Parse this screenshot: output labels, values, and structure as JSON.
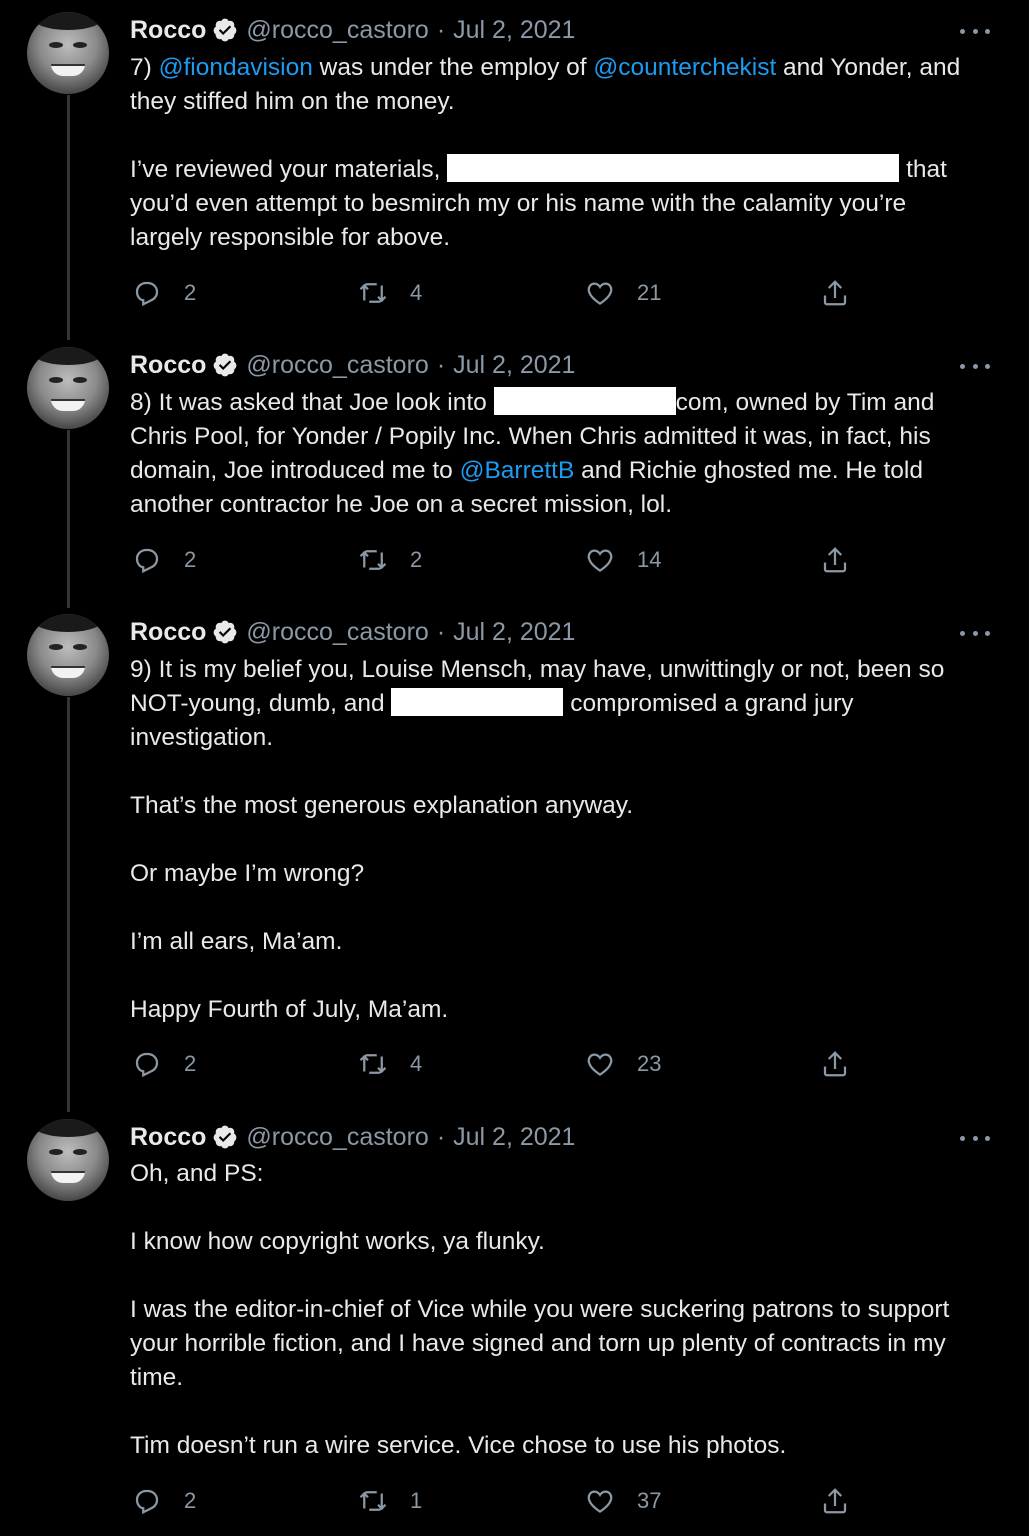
{
  "tweets": [
    {
      "name": "Rocco",
      "handle": "@rocco_castoro",
      "date": "Jul 2, 2021",
      "lines": [
        {
          "t1": "7) ",
          "link1": "@fiondavision",
          "t2": " was under the employ of ",
          "link2": "@counterchekist",
          "t3": " and Yonder, and they stiffed him on the money."
        },
        {
          "pre": "I’ve reviewed your materials, ",
          "post": " that you’d even attempt to besmirch my or his name with the calamity you’re largely responsible for above."
        }
      ],
      "replies": "2",
      "retweets": "4",
      "likes": "21"
    },
    {
      "name": "Rocco",
      "handle": "@rocco_castoro",
      "date": "Jul 2, 2021",
      "pre": "8) It was asked that Joe look into ",
      "mid": "com, owned by Tim and Chris Pool, for Yonder / Popily Inc. When Chris admitted it was, in fact, his domain, Joe introduced me to ",
      "link": "@BarrettB",
      "post": " and Richie ghosted me. He told another contractor he Joe on a secret mission, lol.",
      "replies": "2",
      "retweets": "2",
      "likes": "14"
    },
    {
      "name": "Rocco",
      "handle": "@rocco_castoro",
      "date": "Jul 2, 2021",
      "pre": "9) It is my belief you, Louise Mensch, may have, unwittingly or not, been so NOT-young, dumb, and ",
      "post": " compromised a grand jury investigation.",
      "p2": "That’s the most generous explanation anyway.",
      "p3": "Or maybe I’m wrong?",
      "p4": "I’m all ears, Ma’am.",
      "p5": "Happy Fourth of July, Ma’am.",
      "replies": "2",
      "retweets": "4",
      "likes": "23"
    },
    {
      "name": "Rocco",
      "handle": "@rocco_castoro",
      "date": "Jul 2, 2021",
      "p1": "Oh, and PS:",
      "p2": "I know how copyright works, ya flunky.",
      "p3": "I was the editor-in-chief of Vice while you were suckering patrons to support your horrible fiction, and I have signed and torn up plenty of contracts in my time.",
      "p4": "Tim doesn’t run a wire service. Vice chose to use his photos.",
      "replies": "2",
      "retweets": "1",
      "likes": "37"
    }
  ],
  "colors": {
    "background": "#000000",
    "text": "#e7e9ea",
    "muted": "#8b98a5",
    "link": "#1d9bf0",
    "thread_line": "#333639"
  },
  "icons": {
    "verified": "verified-badge-icon",
    "more": "more-options-icon",
    "reply": "reply-icon",
    "retweet": "retweet-icon",
    "like": "heart-icon",
    "share": "share-icon"
  }
}
